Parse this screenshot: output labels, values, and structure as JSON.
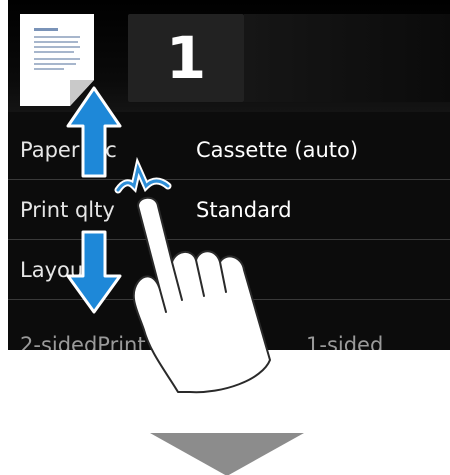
{
  "copies": {
    "value": "1"
  },
  "settings": [
    {
      "label": "Paper src",
      "value": "Cassette (auto)"
    },
    {
      "label": "Print qlty",
      "value": "Standard"
    },
    {
      "label": "Layout",
      "value": ""
    },
    {
      "label": "2-sidedPrint",
      "value": "1-sided"
    }
  ],
  "icons": {
    "document": "document-icon",
    "scroll_up": "arrow-up-icon",
    "scroll_down": "arrow-down-icon",
    "tap": "tap-sparkle-icon",
    "hand": "pointing-hand-icon",
    "next_step": "chevron-down-icon"
  },
  "colors": {
    "screen_bg": "#0c0c0c",
    "arrow_blue": "#1e88d8",
    "step_arrow": "#8c8c8c",
    "tap_mark": "#2f8fd8"
  }
}
